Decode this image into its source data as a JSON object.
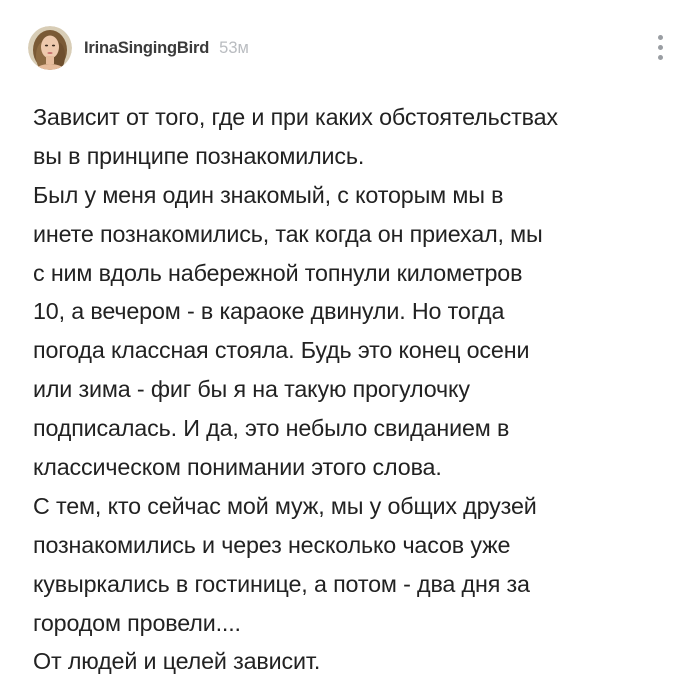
{
  "comment": {
    "author": "IrinaSingingBird",
    "time": "53м",
    "avatar_icon": "user-avatar-photo",
    "menu_icon": "vertical-dots-icon",
    "lines": [
      "Зависит от того, где и при каких обстоятельствах",
      "вы в принципе познакомились.",
      "Был у меня один знакомый, с которым мы в",
      "инете познакомились, так когда он приехал, мы",
      "с ним вдоль набережной топнули километров",
      "10, а вечером - в караоке двинули. Но тогда",
      "погода классная стояла. Будь это конец осени",
      "или зима - фиг бы я на такую прогулочку",
      "подписалась. И да, это небыло свиданием в",
      "классическом понимании этого слова.",
      "С тем, кто сейчас мой муж, мы у общих друзей",
      "познакомились и через несколько часов уже",
      "кувыркались в гостинице, а потом - два дня за",
      "городом провели....",
      "От людей и целей зависит."
    ]
  }
}
